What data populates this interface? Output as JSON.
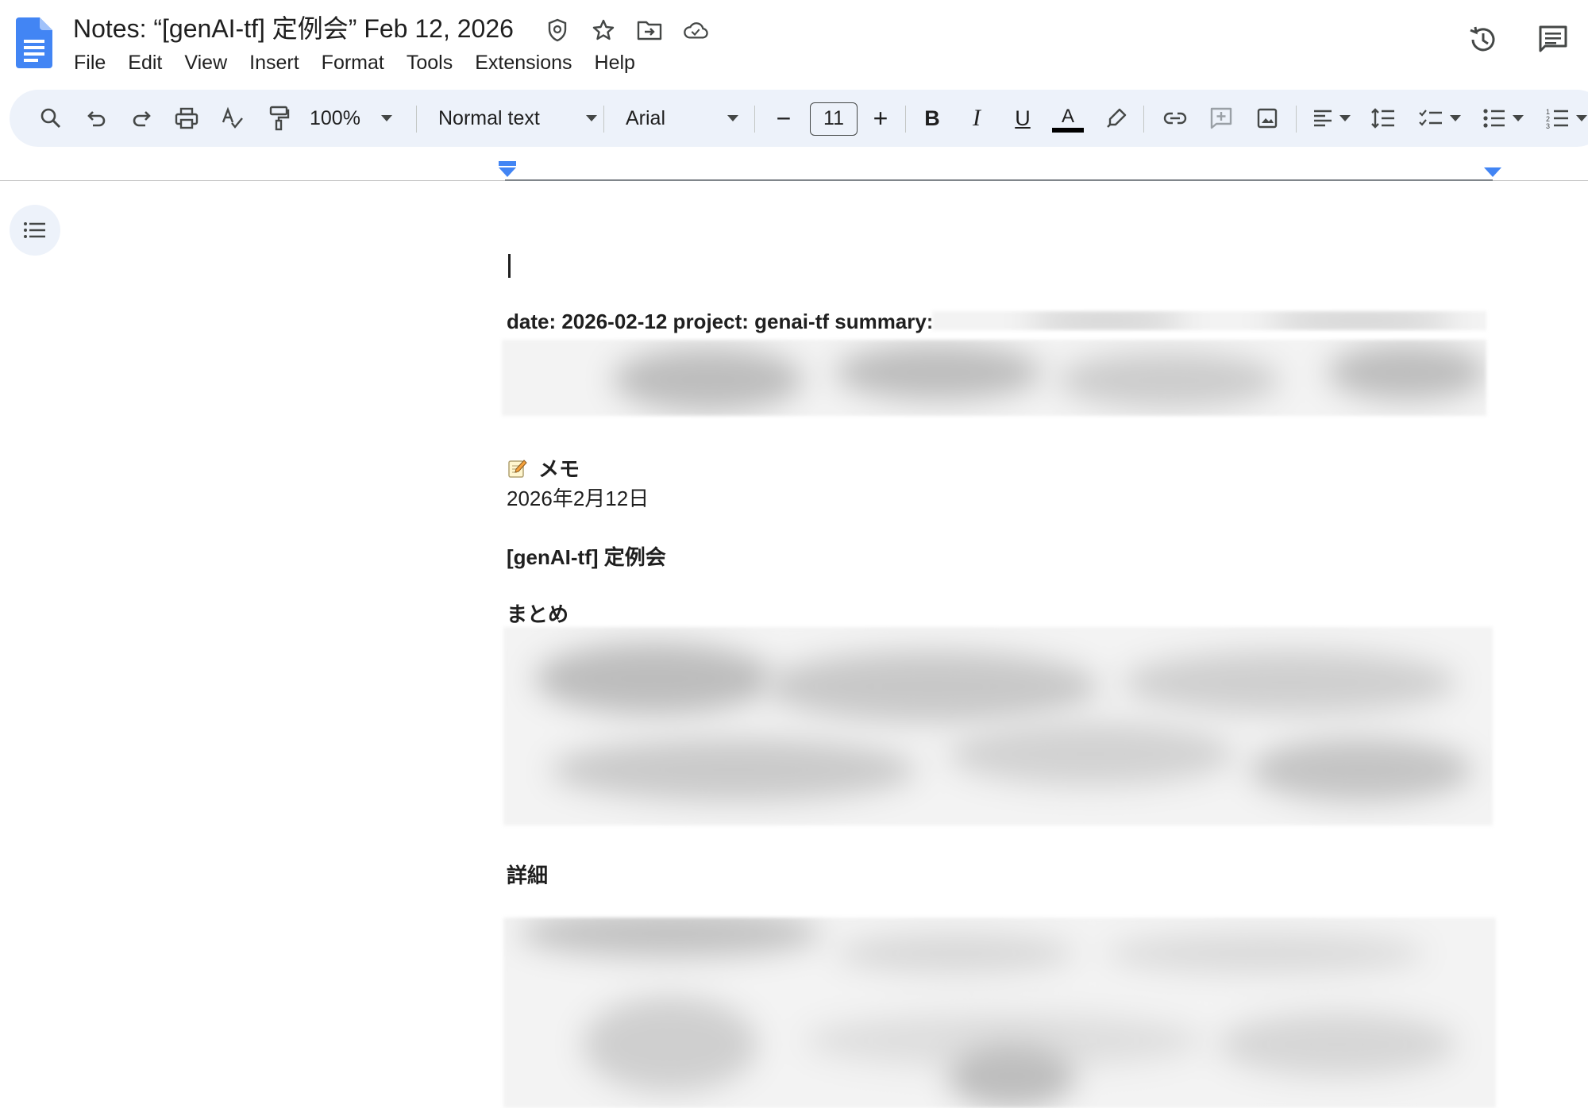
{
  "app": {
    "doc_title": "Notes: “[genAI-tf] 定例会” Feb 12, 2026",
    "icons": [
      "docs-logo-icon",
      "move-to-shared-drive-icon",
      "star-icon",
      "move-folder-icon",
      "cloud-saved-icon",
      "history-icon",
      "comments-icon"
    ]
  },
  "menu": {
    "items": [
      "File",
      "Edit",
      "View",
      "Insert",
      "Format",
      "Tools",
      "Extensions",
      "Help"
    ]
  },
  "toolbar": {
    "zoom": "100%",
    "style": "Normal text",
    "font": "Arial",
    "font_size": "11",
    "decrease_label": "−",
    "increase_label": "+",
    "bold": "B",
    "italic": "I",
    "underline": "U",
    "text_color_label": "A",
    "text_color": "#000000",
    "accent_color": "#1a73e8"
  },
  "document": {
    "frontmatter": "date: 2026-02-12 project: genai-tf summary:",
    "memo_heading": "メモ",
    "date_line": "2026年2月12日",
    "meeting_title": "[genAI-tf] 定例会",
    "summary_heading": "まとめ",
    "details_heading": "詳細"
  }
}
